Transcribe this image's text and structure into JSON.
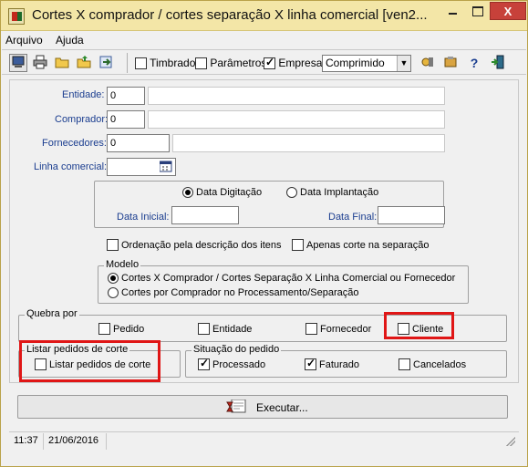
{
  "window": {
    "title": "Cortes X comprador / cortes separação X linha comercial [ven2...",
    "close_label": "X"
  },
  "menu": {
    "items": [
      "Arquivo",
      "Ajuda"
    ]
  },
  "toolbar": {
    "timbrado": "Timbrado",
    "parametros": "Parâmetros",
    "empresa": "Empresa",
    "output_mode": "Comprimido"
  },
  "form": {
    "entidade_label": "Entidade:",
    "entidade_value": "0",
    "comprador_label": "Comprador:",
    "comprador_value": "0",
    "fornecedores_label": "Fornecedores:",
    "fornecedores_value": "0",
    "linha_comercial_label": "Linha comercial:"
  },
  "dates": {
    "radio_digitacao": "Data Digitação",
    "radio_implantacao": "Data Implantação",
    "data_inicial_label": "Data Inicial:",
    "data_final_label": "Data Final:"
  },
  "options": {
    "ordenacao": "Ordenação pela descrição dos itens",
    "apenas_corte": "Apenas corte na separação"
  },
  "modelo": {
    "title": "Modelo",
    "opt1": "Cortes X Comprador / Cortes Separação X Linha Comercial ou Fornecedor",
    "opt2": "Cortes por Comprador no Processamento/Separação"
  },
  "quebra": {
    "title": "Quebra por",
    "pedido": "Pedido",
    "entidade": "Entidade",
    "fornecedor": "Fornecedor",
    "cliente": "Cliente"
  },
  "listar": {
    "title": "Listar pedidos de corte",
    "checkbox": "Listar pedidos de corte"
  },
  "situacao": {
    "title": "Situação do pedido",
    "processado": "Processado",
    "faturado": "Faturado",
    "cancelados": "Cancelados"
  },
  "execute": {
    "label": "Executar..."
  },
  "status": {
    "time": "11:37",
    "date": "21/06/2016"
  },
  "colors": {
    "titlebar": "#f3e6a7",
    "label_blue": "#1a3d8f",
    "highlight_red": "#e01616"
  }
}
